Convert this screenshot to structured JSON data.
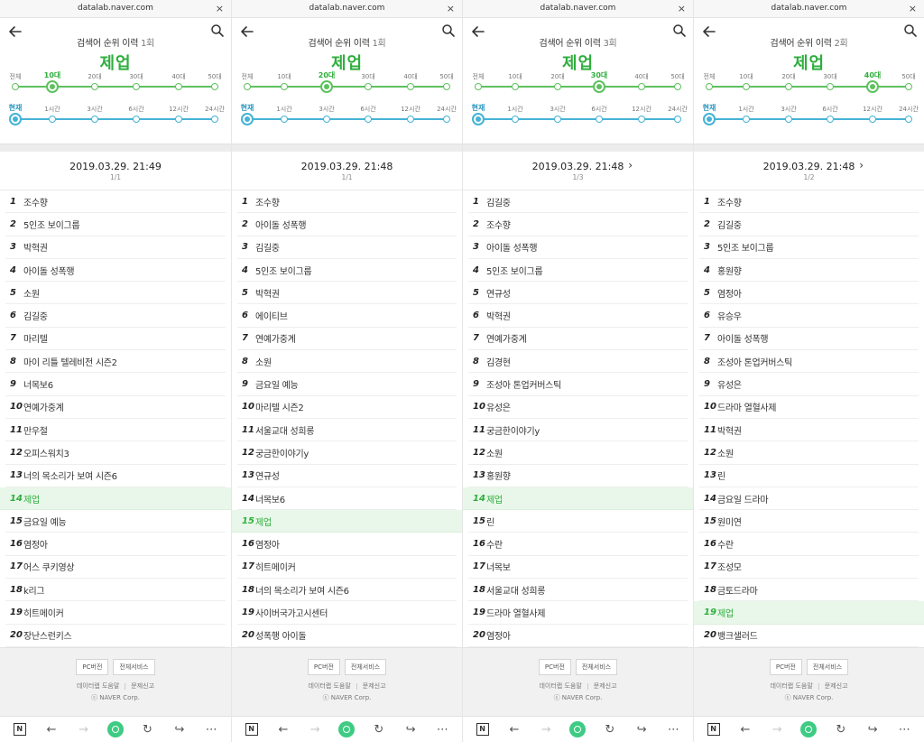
{
  "url": "datalab.naver.com",
  "close_glyph": "×",
  "title_prefix": "검색어 순위 이력",
  "keyword": "제업",
  "age_ticks": [
    "전체",
    "10대",
    "20대",
    "30대",
    "40대",
    "50대"
  ],
  "time_ticks": [
    "현재",
    "1시간",
    "3시간",
    "6시간",
    "12시간",
    "24시간"
  ],
  "footer": {
    "pc_version": "PC버전",
    "all_services": "전체서비스",
    "help": "데이터랩 도움말",
    "report": "문제신고",
    "copyright": "ⓒ NAVER Corp."
  },
  "colors": {
    "accent_green": "#2fae3e",
    "age_track": "#5ec15f",
    "time_track": "#45b3d6",
    "highlight_bg": "#e8f7e9"
  },
  "panels": [
    {
      "count": "1회",
      "selected_age_index": 1,
      "selected_time_index": 0,
      "date": "2019.03.29. 21:49",
      "page": "1/1",
      "has_next": false,
      "highlight_index": 13,
      "rows": [
        "조수향",
        "5인조 보이그룹",
        "박혁권",
        "아이돌 성폭행",
        "소원",
        "김길중",
        "마리텔",
        "마이 리틀 텔레비전 시즌2",
        "너목보6",
        "연예가중계",
        "만우절",
        "오피스워치3",
        "너의 목소리가 보여 시즌6",
        "제업",
        "금요일 예능",
        "염정아",
        "어스 쿠키영상",
        "k리그",
        "히트메이커",
        "장난스런키스"
      ]
    },
    {
      "count": "1회",
      "selected_age_index": 2,
      "selected_time_index": 0,
      "date": "2019.03.29. 21:48",
      "page": "1/1",
      "has_next": false,
      "highlight_index": 14,
      "rows": [
        "조수향",
        "아이돌 성폭행",
        "김길중",
        "5인조 보이그룹",
        "박혁권",
        "에이티브",
        "연예가중계",
        "소원",
        "금요일 예능",
        "마리텔 시즌2",
        "서울교대 성희롱",
        "궁금한이야기y",
        "연규성",
        "너목보6",
        "제업",
        "염정아",
        "히트메이커",
        "너의 목소리가 보여 시즌6",
        "사이버국가고시센터",
        "성폭행 아이돌"
      ]
    },
    {
      "count": "3회",
      "selected_age_index": 3,
      "selected_time_index": 0,
      "date": "2019.03.29. 21:48",
      "page": "1/3",
      "has_next": true,
      "highlight_index": 13,
      "rows": [
        "김길중",
        "조수향",
        "아이돌 성폭행",
        "5인조 보이그룹",
        "연규성",
        "박혁권",
        "연예가중계",
        "김경현",
        "조성아 톤업커버스틱",
        "유성은",
        "궁금한이야기y",
        "소원",
        "홍원향",
        "제업",
        "린",
        "수란",
        "너목보",
        "서울교대 성희롱",
        "드라마 열혈사제",
        "염정아"
      ]
    },
    {
      "count": "2회",
      "selected_age_index": 4,
      "selected_time_index": 0,
      "date": "2019.03.29. 21:48",
      "page": "1/2",
      "has_next": true,
      "highlight_index": 18,
      "rows": [
        "조수향",
        "김길중",
        "5인조 보이그룹",
        "홍원향",
        "염정아",
        "유승우",
        "아이돌 성폭행",
        "조성아 톤업커버스틱",
        "유성은",
        "드라마 열혈사제",
        "박혁권",
        "소원",
        "린",
        "금요일 드라마",
        "원미연",
        "수란",
        "조성모",
        "금토드라마",
        "제업",
        "뱅크샐러드"
      ]
    }
  ]
}
